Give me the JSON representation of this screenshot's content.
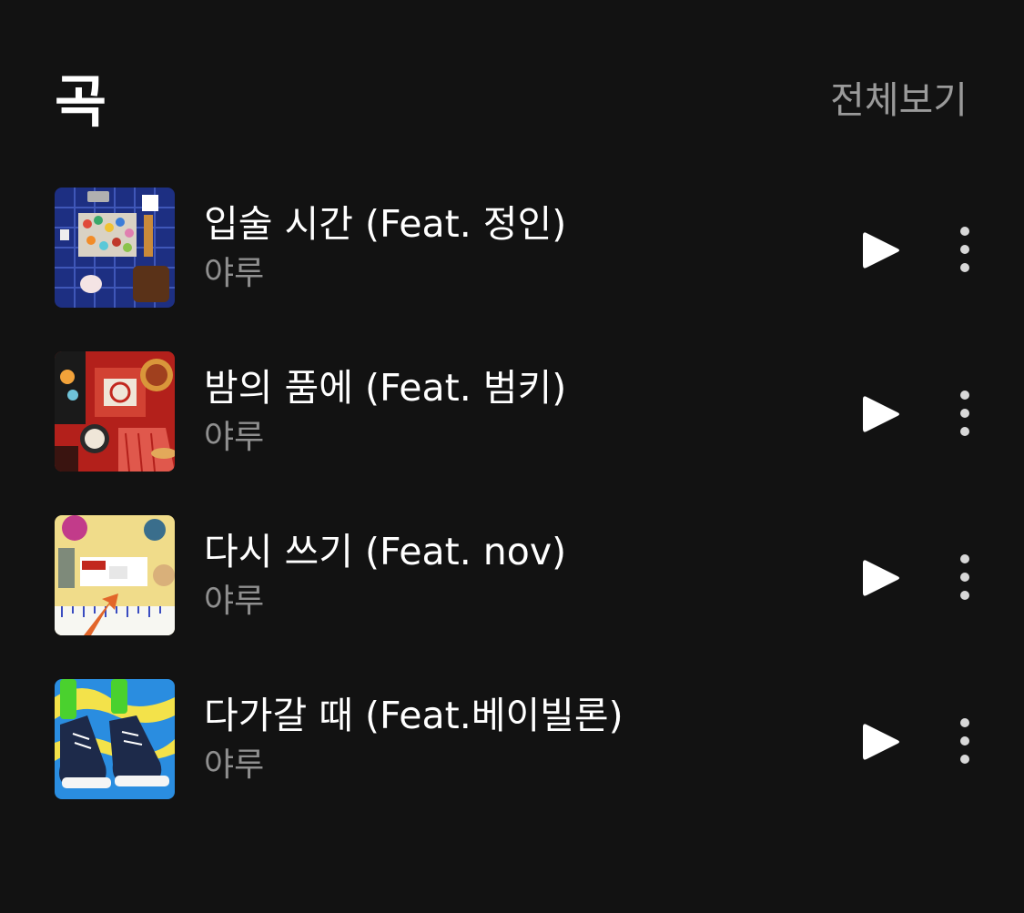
{
  "section": {
    "title": "곡",
    "view_all": "전체보기"
  },
  "songs": [
    {
      "title": "입술 시간 (Feat. 정인)",
      "artist": "야루"
    },
    {
      "title": "밤의 품에 (Feat. 범키)",
      "artist": "야루"
    },
    {
      "title": "다시 쓰기 (Feat. nov)",
      "artist": "야루"
    },
    {
      "title": "다가갈 때 (Feat.베이빌론)",
      "artist": "야루"
    }
  ],
  "icons": {
    "play": "play-icon",
    "more": "more-vertical-icon"
  },
  "colors": {
    "background": "#121212",
    "primary_text": "#ffffff",
    "secondary_text": "#8f8f8f",
    "view_all_text": "#9a9a9a"
  }
}
